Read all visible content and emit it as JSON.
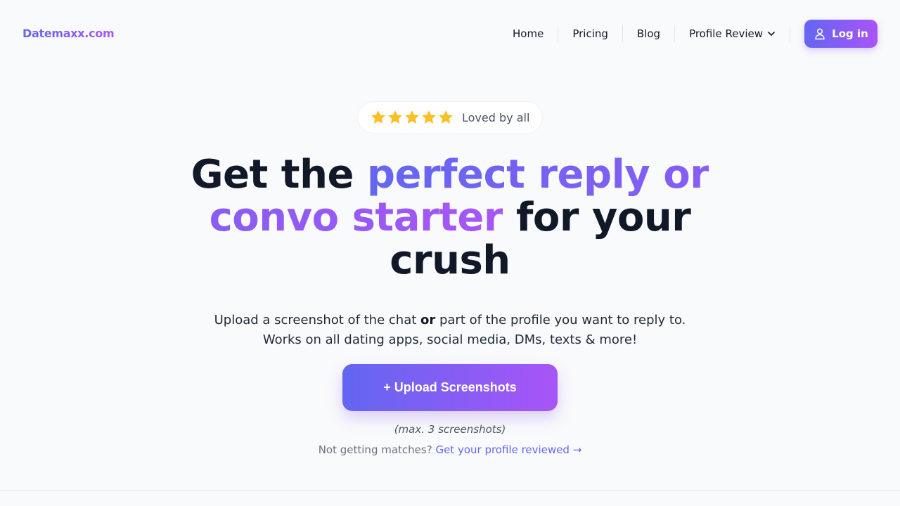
{
  "header": {
    "logo": "Datemaxx.com",
    "nav": [
      "Home",
      "Pricing",
      "Blog"
    ],
    "dropdown_label": "Profile Review",
    "login_label": "Log in"
  },
  "colors": {
    "accent_start": "#6366f1",
    "accent_end": "#a855f7",
    "star": "#fbbf24"
  },
  "rating": {
    "stars": 5,
    "label": "Loved by all"
  },
  "hero": {
    "headline_pre": "Get the ",
    "headline_highlight": "perfect reply or convo starter",
    "headline_post": " for your crush",
    "subtext_part1": "Upload a screenshot of the chat ",
    "subtext_bold": "or",
    "subtext_part2": " part of the profile you want to reply to.",
    "subtext_line2": "Works on all dating apps, social media, DMs, texts & more!",
    "upload_label": "+ Upload Screenshots",
    "max_note": "(max. 3 screenshots)",
    "review_prompt": "Not getting matches? ",
    "review_link": "Get your profile reviewed →"
  },
  "icons": [
    "chevron-down-icon",
    "user-icon",
    "star-icon"
  ]
}
